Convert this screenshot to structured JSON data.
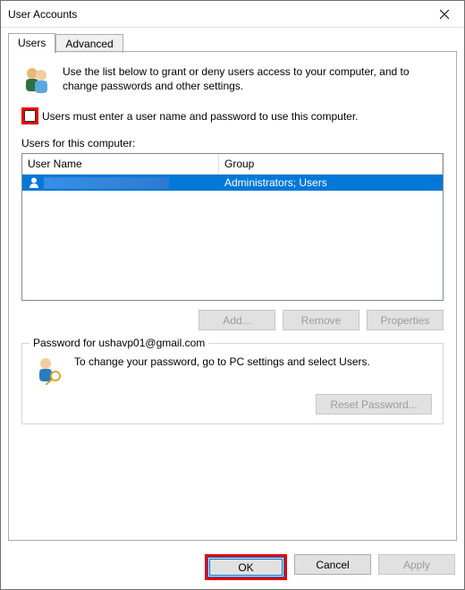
{
  "window": {
    "title": "User Accounts"
  },
  "tabs": {
    "users": "Users",
    "advanced": "Advanced"
  },
  "intro": "Use the list below to grant or deny users access to your computer, and to change passwords and other settings.",
  "checkbox_label": "Users must enter a user name and password to use this computer.",
  "list_label": "Users for this computer:",
  "columns": {
    "username": "User Name",
    "group": "Group"
  },
  "row": {
    "username": "",
    "group": "Administrators; Users"
  },
  "buttons": {
    "add": "Add...",
    "remove": "Remove",
    "properties": "Properties",
    "reset_password": "Reset Password...",
    "ok": "OK",
    "cancel": "Cancel",
    "apply": "Apply"
  },
  "password_group": {
    "legend": "Password for ushavp01@gmail.com",
    "text": "To change your password, go to PC settings and select Users."
  }
}
